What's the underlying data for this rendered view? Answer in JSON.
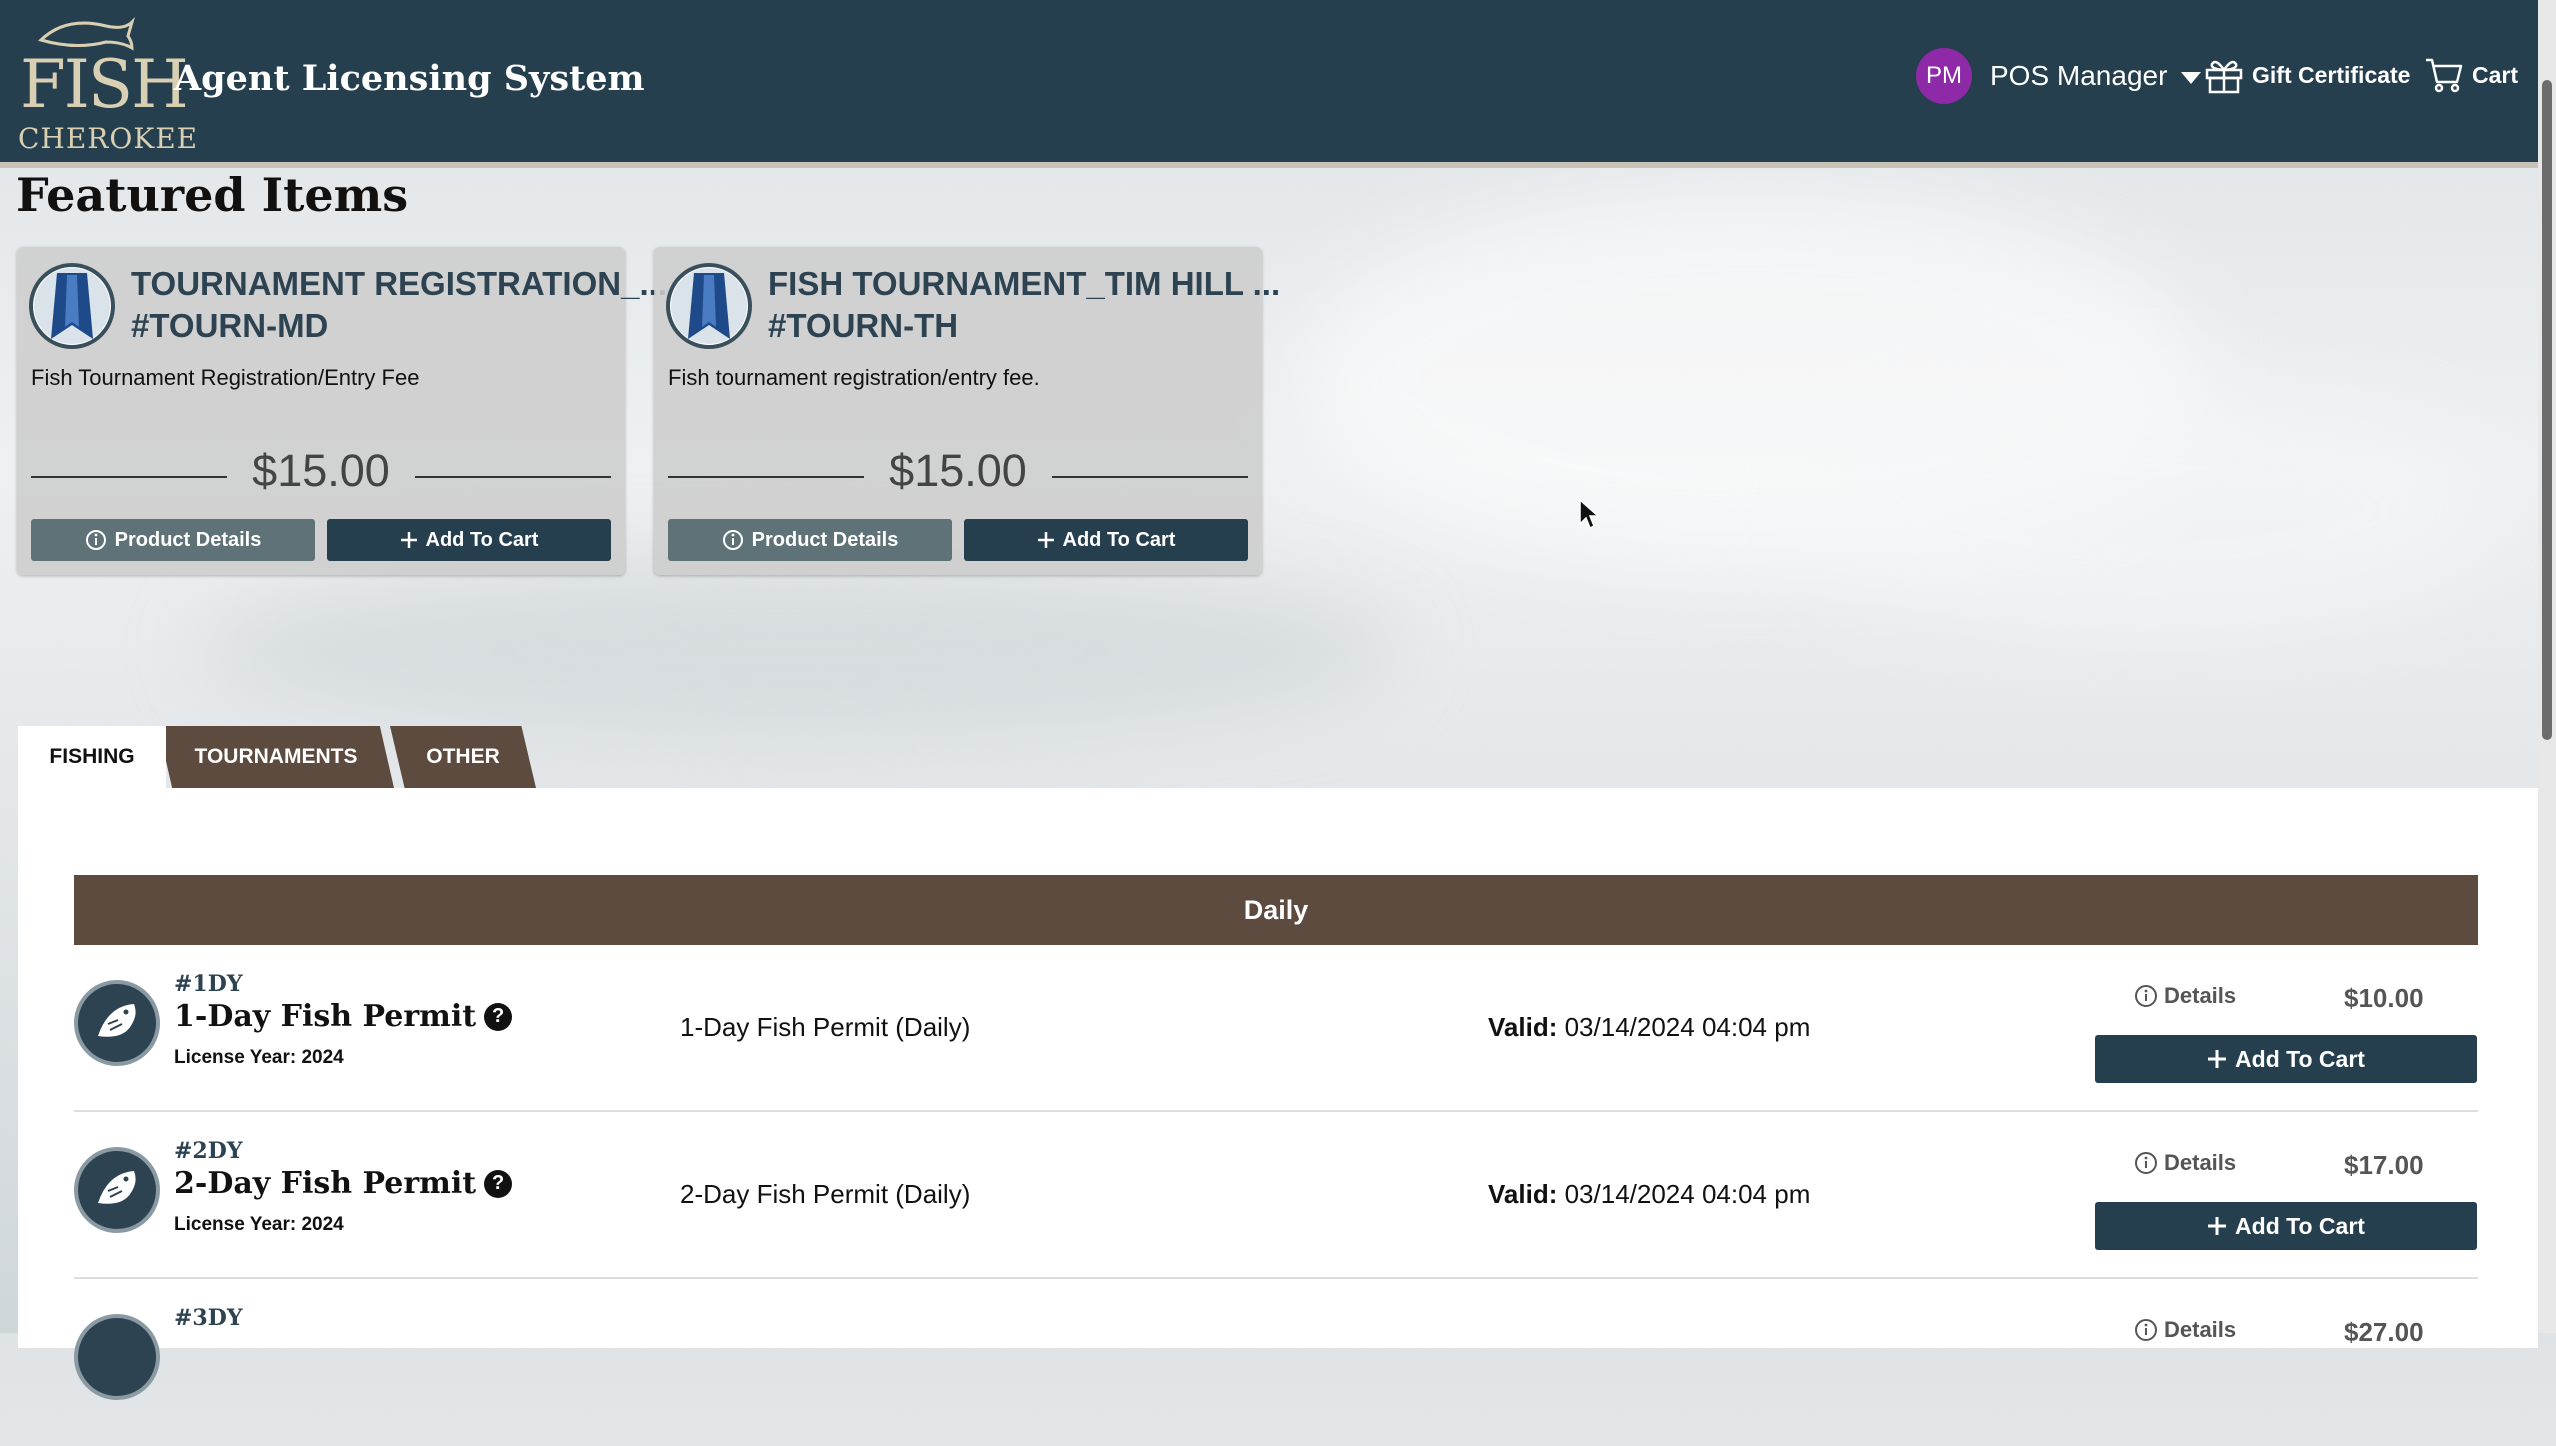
{
  "header": {
    "logo_text_top": "FISH",
    "logo_text_bottom": "CHEROKEE",
    "app_title": "Agent Licensing System",
    "user_initials": "PM",
    "user_name": "POS Manager",
    "gift_label": "Gift Certificate",
    "cart_label": "Cart"
  },
  "featured": {
    "title": "Featured Items",
    "items": [
      {
        "title_line1": "TOURNAMENT REGISTRATION_...",
        "title_line2": "#TOURN-MD",
        "description": "Fish Tournament Registration/Entry Fee",
        "price": "$15.00",
        "details_label": "Product Details",
        "add_label": "Add To Cart"
      },
      {
        "title_line1": "FISH TOURNAMENT_TIM HILL ...",
        "title_line2": "#TOURN-TH",
        "description": "Fish tournament registration/entry fee.",
        "price": "$15.00",
        "details_label": "Product Details",
        "add_label": "Add To Cart"
      }
    ]
  },
  "tabs": [
    {
      "label": "FISHING",
      "active": true
    },
    {
      "label": "TOURNAMENTS",
      "active": false
    },
    {
      "label": "OTHER",
      "active": false
    }
  ],
  "section": {
    "title": "Daily"
  },
  "products": [
    {
      "code": "#1DY",
      "name": "1-Day Fish Permit",
      "license_year": "License Year: 2024",
      "description": "1-Day Fish Permit (Daily)",
      "valid_label": "Valid:",
      "valid_value": "03/14/2024 04:04 pm",
      "details_label": "Details",
      "price": "$10.00",
      "add_label": "Add To Cart"
    },
    {
      "code": "#2DY",
      "name": "2-Day Fish Permit",
      "license_year": "License Year: 2024",
      "description": "2-Day Fish Permit (Daily)",
      "valid_label": "Valid:",
      "valid_value": "03/14/2024 04:04 pm",
      "details_label": "Details",
      "price": "$17.00",
      "add_label": "Add To Cart"
    },
    {
      "code": "#3DY",
      "details_label": "Details",
      "price": "$27.00"
    }
  ],
  "colors": {
    "header_bg": "#253f4e",
    "avatar_bg": "#8e2aa8",
    "tab_bg": "#5c4b3e",
    "primary_button": "#263f4f",
    "secondary_button": "#5f7277"
  },
  "icons": [
    "fish-logo-icon",
    "chevron-down-icon",
    "gift-icon",
    "cart-icon",
    "ribbon-icon",
    "info-icon",
    "plus-icon",
    "fish-badge-icon",
    "help-icon"
  ]
}
